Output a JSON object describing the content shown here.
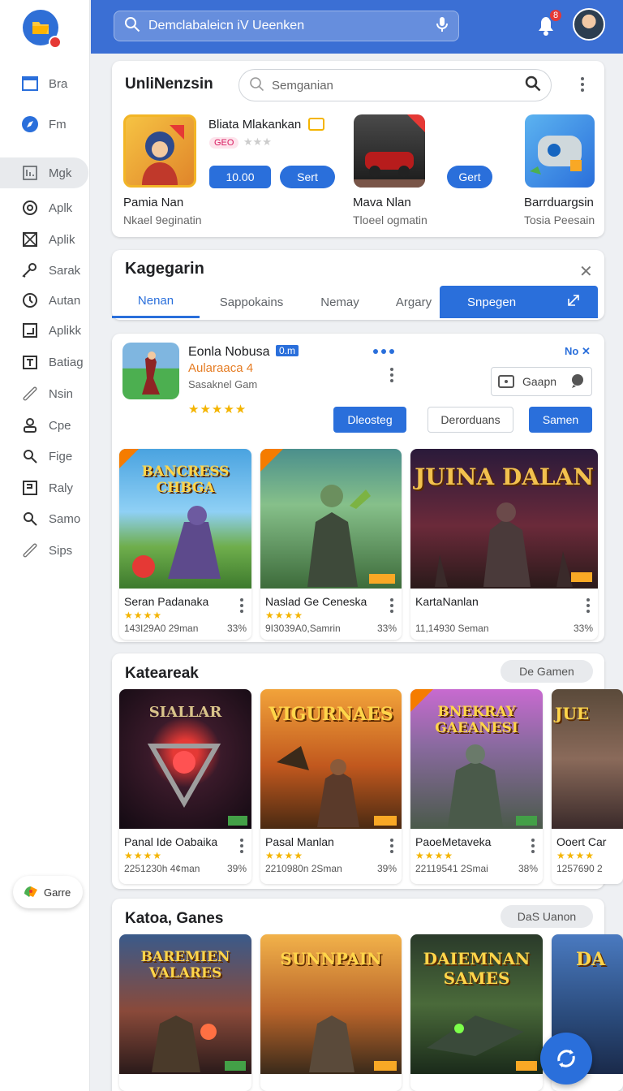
{
  "header": {
    "search_text": "Demclabaleicn iV Ueenken",
    "notification_count": "8"
  },
  "sidebar": {
    "items": [
      {
        "label": "Bra",
        "icon": "window-icon"
      },
      {
        "label": "Fm",
        "icon": "compass-icon"
      },
      {
        "label": "Mgk",
        "icon": "apps-icon"
      },
      {
        "label": "Aplk",
        "icon": "circle-icon"
      },
      {
        "label": "Aplik",
        "icon": "box-x-icon"
      },
      {
        "label": "Sarak",
        "icon": "key-icon"
      },
      {
        "label": "Autan",
        "icon": "clock-icon"
      },
      {
        "label": "Aplikk",
        "icon": "square-chart-icon"
      },
      {
        "label": "Batiag",
        "icon": "calendar-icon"
      },
      {
        "label": "Nsin",
        "icon": "link-icon"
      },
      {
        "label": "Cpe",
        "icon": "person-icon"
      },
      {
        "label": "Fige",
        "icon": "search-icon"
      },
      {
        "label": "Raly",
        "icon": "square-icon"
      },
      {
        "label": "Samo",
        "icon": "search-icon"
      },
      {
        "label": "Sips",
        "icon": "link-icon"
      }
    ],
    "game_chip": "Garre"
  },
  "featured": {
    "title": "UnliNenzsin",
    "search_placeholder": "Semganian",
    "apps": [
      {
        "name": "Pamia Nan",
        "sub": "Nkael 9eginatin"
      },
      {
        "name": "Mava Nlan",
        "sub": "Tloeel ogmatin"
      },
      {
        "name": "Barrduargsin",
        "sub": "Tosia Peesain"
      }
    ],
    "hero_title": "Bliata Mlakankan",
    "hero_tag": "GEO",
    "price_label": "10.00",
    "get_label": "Sert",
    "get_label_2": "Gert"
  },
  "categories": {
    "title": "Kagegarin",
    "tabs": [
      "Nenan",
      "Sappokains",
      "Nemay",
      "Argary",
      "Snpegen"
    ],
    "active_tab": 0
  },
  "detail": {
    "title": "Eonla Nobusa",
    "badge": "0.m",
    "subtitle": "Aularaaca 4",
    "developer": "Sasaknel Gam",
    "close_text": "No",
    "gaapn_label": "Gaapn",
    "buttons": {
      "primary": "Dleosteg",
      "secondary": "Derorduans",
      "tertiary": "Samen"
    }
  },
  "row1": [
    {
      "art": "BANCRESS CHBGA",
      "name": "Seran Padanaka",
      "meta": "143I29A0 29man",
      "pct": "33%",
      "tag": "✦"
    },
    {
      "art": "",
      "name": "Naslad Ge Ceneska",
      "meta": "9I3039A0,Samrin",
      "pct": "33%",
      "tag": "✦"
    },
    {
      "art": "JUINA DALAN",
      "name": "KartaNanlan",
      "meta": "11,14930 Seman",
      "pct": "33%",
      "tag": "✦"
    }
  ],
  "section2": {
    "title": "Kateareak",
    "button": "De Gamen",
    "tiles": [
      {
        "art": "SIALLAR",
        "name": "Panal Ide Oabaika",
        "meta": "2251230h 4¢man",
        "pct": "39%",
        "tag": "GB"
      },
      {
        "art": "VIGURNAES",
        "name": "Pasal Manlan",
        "meta": "2210980n 2Sman",
        "pct": "39%",
        "tag": "GB"
      },
      {
        "art": "BNEKRAY GAEANESI",
        "name": "PaoeMetaveka",
        "meta": "22119541 2Smai",
        "pct": "38%",
        "tag": "GB"
      },
      {
        "art": "JUE",
        "name": "Ooert Car",
        "meta": "1257690 2",
        "pct": "",
        "tag": ""
      }
    ]
  },
  "section3": {
    "title": "Katoa, Ganes",
    "button": "DaS Uanon",
    "tiles": [
      {
        "art": "BAREMIEN VALARES",
        "tag": "Gne"
      },
      {
        "art": "SUNNPAIN",
        "tag": "GB"
      },
      {
        "art": "DAIEMNAN SAMES",
        "tag": "GB"
      },
      {
        "art": "DA",
        "tag": ""
      }
    ]
  },
  "colors": {
    "brand": "#3b6fd4",
    "accent": "#2a6fdb",
    "star": "#f4b400",
    "alert": "#e53935"
  }
}
